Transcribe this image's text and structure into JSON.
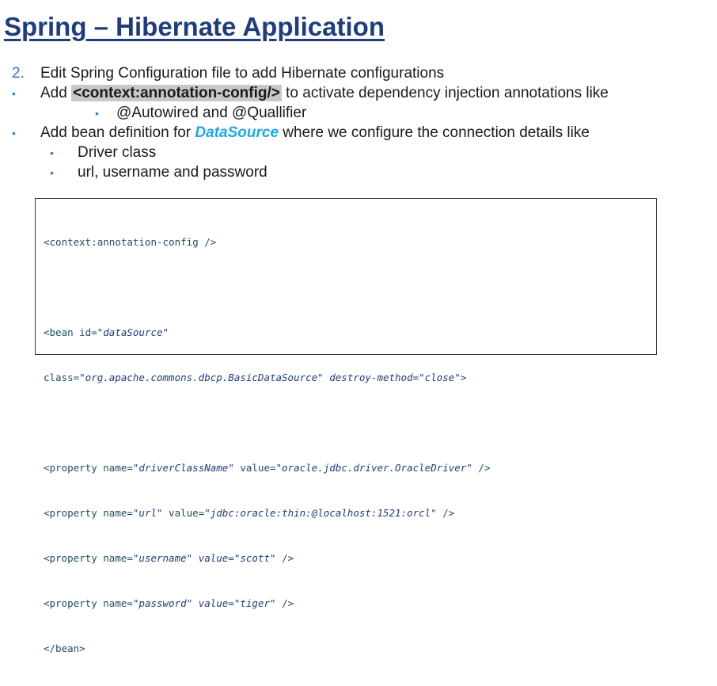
{
  "title": "Spring – Hibernate Application",
  "item2": {
    "num": "2.",
    "text": "Edit Spring Configuration file to add Hibernate configurations"
  },
  "bullet_symbol": "•",
  "item_annotation": {
    "prefix": "Add ",
    "code": "<context:annotation-config/>",
    "suffix": " to activate dependency injection annotations like",
    "sub": [
      "@Autowired and @Quallifier"
    ]
  },
  "item_datasource": {
    "prefix": "Add bean definition for ",
    "highlight": "DataSource",
    "suffix": " where we configure the connection details like",
    "sub": [
      "Driver class",
      "url, username and password"
    ]
  },
  "code": {
    "line1": "<context:annotation-config />",
    "bean_open": "<bean ",
    "bean_id_attr": "id=",
    "bean_id_val": "\"dataSource\"",
    "class_attr": "class=",
    "class_val": "\"org.apache.commons.dbcp.BasicDataSource\"",
    "destroy_attr": " destroy-method=",
    "destroy_val": "\"close\"",
    "bean_close_bracket": ">",
    "props": [
      {
        "lead": "<property ",
        "n_attr": "name=",
        "n_val": "\"driverClassName\"",
        "v_attr": " value=",
        "v_val": "\"oracle.jdbc.driver.OracleDriver\"",
        "end": " />"
      },
      {
        "lead": "<property ",
        "n_attr": "name=",
        "n_val": "\"url\"",
        "v_attr": " value=",
        "v_val": "\"jdbc:oracle:thin:@localhost:1521:orcl\"",
        "end": " />"
      },
      {
        "lead": "<property ",
        "n_attr": "name=",
        "n_val": "\"username\"",
        "v_attr": " value=",
        "v_val": "\"scott\"",
        "end": " />"
      },
      {
        "lead": "<property ",
        "n_attr": "name=",
        "n_val": "\"password\"",
        "v_attr": " value=",
        "v_val": "\"tiger\"",
        "end": " />"
      }
    ],
    "end_bean": "</bean>"
  }
}
